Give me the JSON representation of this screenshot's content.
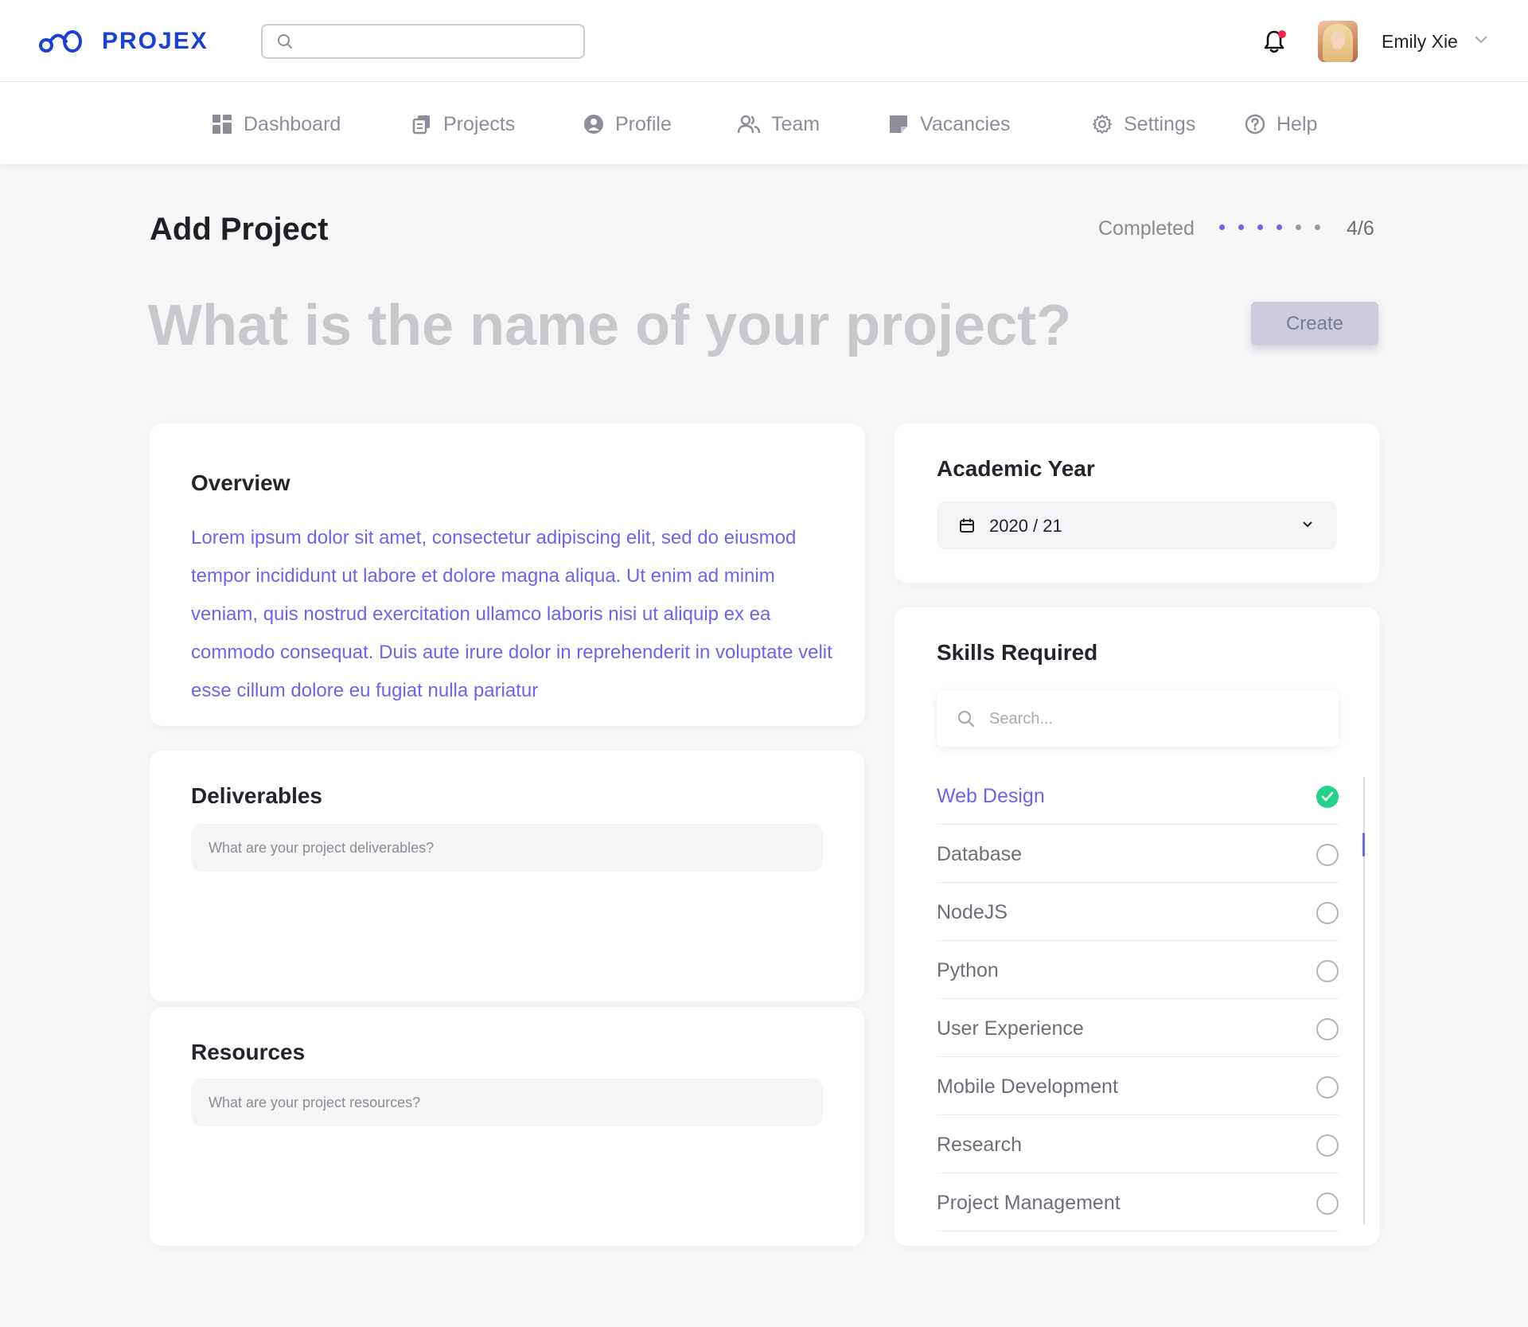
{
  "brand": {
    "name": "PROJEX",
    "color": "#1a3fd8"
  },
  "header": {
    "search": {
      "value": "",
      "placeholder": ""
    },
    "notification_badge_color": "#f0264f",
    "user": {
      "name": "Emily Xie"
    }
  },
  "nav": {
    "items": [
      {
        "label": "Dashboard",
        "icon": "dashboard-icon"
      },
      {
        "label": "Projects",
        "icon": "projects-icon"
      },
      {
        "label": "Profile",
        "icon": "profile-icon"
      },
      {
        "label": "Team",
        "icon": "team-icon"
      },
      {
        "label": "Vacancies",
        "icon": "vacancies-icon"
      },
      {
        "label": "Settings",
        "icon": "settings-icon"
      },
      {
        "label": "Help",
        "icon": "help-icon"
      }
    ]
  },
  "page": {
    "title": "Add Project",
    "progress": {
      "label": "Completed",
      "count_text": "4/6",
      "completed": 4,
      "total": 6,
      "active_color": "#6c63ef",
      "inactive_color": "#9a9aa6"
    },
    "project_name_placeholder": "What is the name of your project?",
    "create_label": "Create"
  },
  "overview": {
    "title": "Overview",
    "text": "Lorem ipsum dolor sit amet, consectetur adipiscing elit, sed do eiusmod tempor incididunt ut labore et dolore magna aliqua. Ut enim ad minim veniam, quis nostrud exercitation ullamco laboris nisi ut aliquip ex ea commodo consequat. Duis aute irure dolor in reprehenderit in voluptate velit esse cillum dolore eu fugiat nulla pariatur"
  },
  "deliverables": {
    "title": "Deliverables",
    "placeholder": "What are your project deliverables?"
  },
  "resources": {
    "title": "Resources",
    "placeholder": "What are your project resources?"
  },
  "academic_year": {
    "title": "Academic Year",
    "selected": "2020 / 21"
  },
  "skills": {
    "title": "Skills Required",
    "search_placeholder": "Search...",
    "accent_color": "#6c63ef",
    "check_color": "#22d388",
    "items": [
      {
        "label": "Web Design",
        "selected": true
      },
      {
        "label": "Database",
        "selected": false
      },
      {
        "label": "NodeJS",
        "selected": false
      },
      {
        "label": "Python",
        "selected": false
      },
      {
        "label": "User Experience",
        "selected": false
      },
      {
        "label": "Mobile Development",
        "selected": false
      },
      {
        "label": "Research",
        "selected": false
      },
      {
        "label": "Project Management",
        "selected": false
      }
    ]
  }
}
